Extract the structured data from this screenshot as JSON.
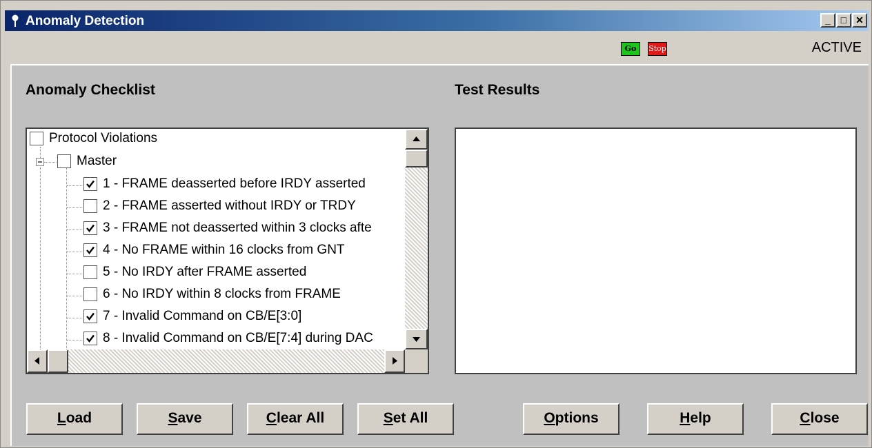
{
  "window": {
    "title": "Anomaly Detection",
    "controls": {
      "minimize": "_",
      "maximize": "□",
      "close": "✕"
    }
  },
  "statusbar": {
    "go_label": "Go",
    "stop_label": "Stop",
    "status": "ACTIVE",
    "go_color": "#1ec41e",
    "stop_color": "#e01818"
  },
  "checklist": {
    "heading": "Anomaly Checklist",
    "root": {
      "label": "Protocol Violations",
      "checked": false
    },
    "group": {
      "label": "Master",
      "checked": false,
      "expanded": true
    },
    "items": [
      {
        "label": "1 - FRAME deasserted before IRDY asserted",
        "checked": true
      },
      {
        "label": "2 - FRAME asserted without IRDY or TRDY",
        "checked": false
      },
      {
        "label": "3 - FRAME not deasserted within 3 clocks afte",
        "checked": true
      },
      {
        "label": "4 - No FRAME within 16 clocks from GNT",
        "checked": true
      },
      {
        "label": "5 - No IRDY after FRAME asserted",
        "checked": false
      },
      {
        "label": "6 - No IRDY within 8 clocks from FRAME",
        "checked": false
      },
      {
        "label": "7 - Invalid Command on CB/E[3:0]",
        "checked": true
      },
      {
        "label": "8 - Invalid Command on CB/E[7:4] during DAC",
        "checked": true
      }
    ]
  },
  "results": {
    "heading": "Test Results"
  },
  "buttons": {
    "load": {
      "mnemonic": "L",
      "rest": "oad"
    },
    "save": {
      "mnemonic": "S",
      "rest": "ave"
    },
    "clear_all": {
      "mnemonic": "C",
      "rest": "lear All"
    },
    "set_all": {
      "mnemonic": "S",
      "rest": "et All"
    },
    "options": {
      "mnemonic": "O",
      "rest": "ptions"
    },
    "help": {
      "mnemonic": "H",
      "rest": "elp"
    },
    "close": {
      "mnemonic": "C",
      "rest": "lose"
    }
  }
}
